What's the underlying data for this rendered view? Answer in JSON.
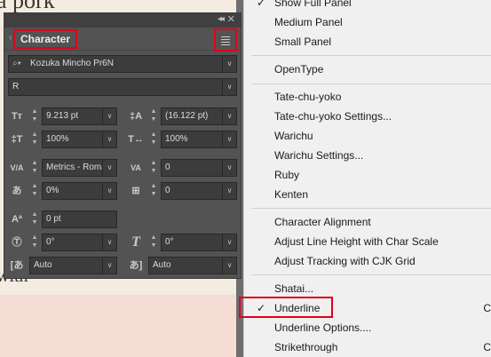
{
  "document": {
    "top_text": "a pork",
    "bottom_text": "with"
  },
  "panel": {
    "tab_label": "Character",
    "font_family": "Kozuka Mincho Pr6N",
    "font_style": "R",
    "font_size": "9.213 pt",
    "leading": "(16.122 pt)",
    "vertical_scale": "100%",
    "horizontal_scale": "100%",
    "kerning": "Metrics - Roman",
    "tracking": "0",
    "tsume": "0%",
    "aki": "0",
    "baseline_shift": "0 pt",
    "rotation": "0°",
    "skew": "0°",
    "aki_left": "Auto",
    "aki_right": "Auto"
  },
  "menu": {
    "items": [
      {
        "label": "Show Full Panel",
        "checked": true
      },
      {
        "label": "Medium Panel"
      },
      {
        "label": "Small Panel"
      },
      {
        "label": "OpenType"
      },
      {
        "label": "Tate-chu-yoko"
      },
      {
        "label": "Tate-chu-yoko Settings..."
      },
      {
        "label": "Warichu"
      },
      {
        "label": "Warichu Settings..."
      },
      {
        "label": "Ruby"
      },
      {
        "label": "Kenten"
      },
      {
        "label": "Character Alignment"
      },
      {
        "label": "Adjust Line Height with Char Scale"
      },
      {
        "label": "Adjust Tracking with CJK Grid"
      },
      {
        "label": "Shatai..."
      },
      {
        "label": "Underline",
        "checked": true,
        "shortcut": "C"
      },
      {
        "label": "Underline Options...."
      },
      {
        "label": "Strikethrough",
        "shortcut": "C"
      }
    ]
  },
  "colors": {
    "highlight": "#e0001b",
    "panel_bg": "#535353",
    "menu_bg": "#f0f0f0"
  }
}
